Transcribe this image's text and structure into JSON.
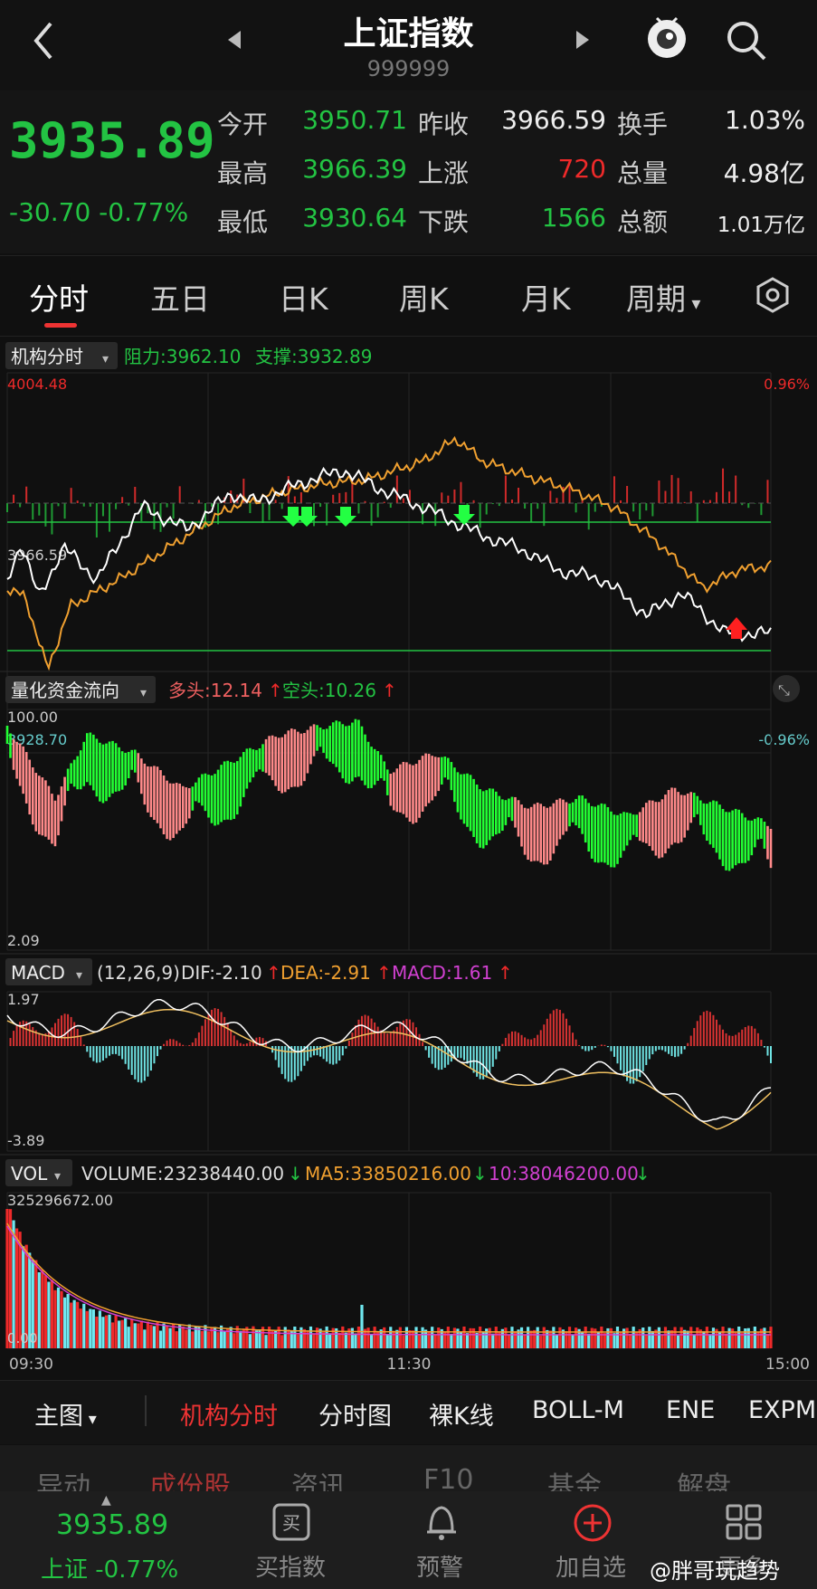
{
  "header": {
    "back_icon": "chevron-left-icon",
    "title": "上证指数",
    "code": "999999",
    "prev_icon": "triangle-left-icon",
    "next_icon": "triangle-right-icon",
    "mascot_icon": "mascot-icon",
    "search_icon": "search-icon"
  },
  "quote": {
    "price": "3935.89",
    "change": "-30.70",
    "change_pct": "-0.77%",
    "rows": [
      [
        {
          "label": "今开",
          "value": "3950.71",
          "color": "green"
        },
        {
          "label": "昨收",
          "value": "3966.59",
          "color": "white"
        },
        {
          "label": "换手",
          "value": "1.03%",
          "color": "white"
        }
      ],
      [
        {
          "label": "最高",
          "value": "3966.39",
          "color": "green"
        },
        {
          "label": "上涨",
          "value": "720",
          "color": "red"
        },
        {
          "label": "总量",
          "value": "4.98亿",
          "color": "white"
        }
      ],
      [
        {
          "label": "最低",
          "value": "3930.64",
          "color": "green"
        },
        {
          "label": "下跌",
          "value": "1566",
          "color": "green"
        },
        {
          "label": "总额",
          "value": "1.01万亿",
          "color": "white"
        }
      ]
    ]
  },
  "tabs": [
    "分时",
    "五日",
    "日K",
    "周K",
    "月K",
    "周期"
  ],
  "settings_icon": "hexagon-settings-icon",
  "main_chart": {
    "indicator": "机构分时",
    "resist": "阻力:3962.10",
    "support": "支撑:3932.89",
    "top_price": "4004.48",
    "top_pct": "0.96%",
    "mid_price": "3966.59",
    "bottom_price": "3928.70",
    "bottom_pct": "-0.96%"
  },
  "flow_chart": {
    "indicator": "量化资金流向",
    "long": "多头:12.14",
    "short": "空头:10.26",
    "top": "100.00",
    "bottom": "2.09"
  },
  "macd_chart": {
    "indicator": "MACD",
    "params": "(12,26,9)",
    "dif": "DIF:-2.10",
    "dea": "DEA:-2.91",
    "macd": "MACD:1.61",
    "top": "1.97",
    "bottom": "-3.89"
  },
  "vol_chart": {
    "indicator": "VOL",
    "volume": "VOLUME:23238440.00",
    "ma5": "MA5:33850216.00",
    "ma10": "10:38046200.00",
    "top": "325296672.00",
    "bottom": "0.00"
  },
  "time_axis": [
    "09:30",
    "11:30",
    "15:00"
  ],
  "sub_toolbar": {
    "main_label": "主图",
    "items": [
      "机构分时",
      "分时图",
      "裸K线",
      "BOLL-M",
      "ENE",
      "EXPM"
    ]
  },
  "bottom_tabs": [
    "异动",
    "成份股",
    "资讯",
    "F10",
    "基金",
    "解盘"
  ],
  "nav": {
    "price": "3935.89",
    "name": "上证 -0.77%",
    "items": [
      "买指数",
      "预警",
      "加自选",
      "更多"
    ],
    "watermark": "@胖哥玩趋势"
  },
  "colors": {
    "up": "#ee2a2a",
    "down": "#23c343",
    "price_line": "#ffffff",
    "avg_line": "#f0a030"
  }
}
